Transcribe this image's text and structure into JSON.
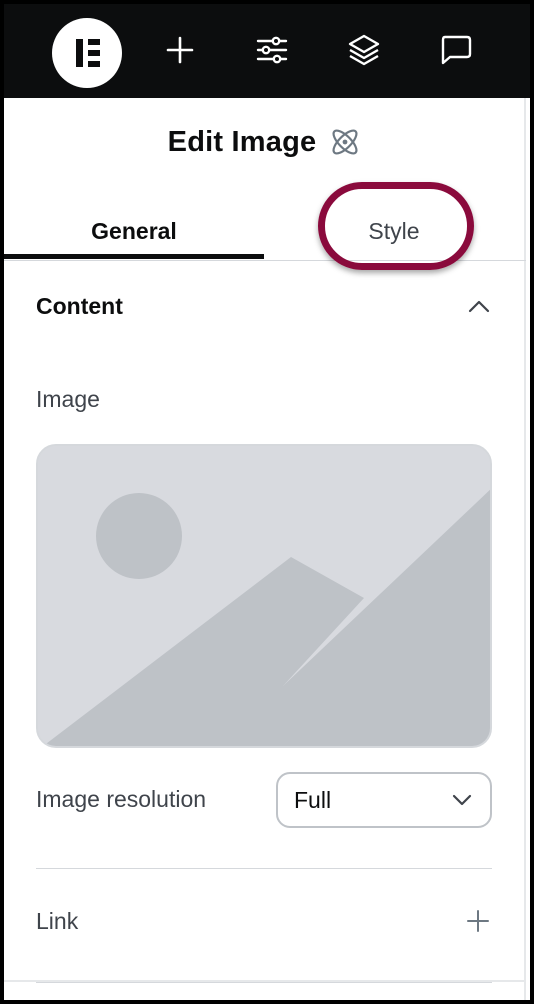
{
  "topbar": {
    "icons": [
      "elementor-logo-icon",
      "plus-icon",
      "sliders-icon",
      "layers-icon",
      "chat-bubble-icon"
    ]
  },
  "panel": {
    "title": "Edit Image",
    "title_icon": "atom-icon",
    "tabs": [
      {
        "label": "General",
        "active": true
      },
      {
        "label": "Style",
        "active": false
      }
    ],
    "highlight_color": "#8a0a3c",
    "section": {
      "title": "Content",
      "expanded": true
    },
    "image": {
      "label": "Image"
    },
    "resolution": {
      "label": "Image resolution",
      "value": "Full"
    },
    "link": {
      "label": "Link"
    }
  }
}
